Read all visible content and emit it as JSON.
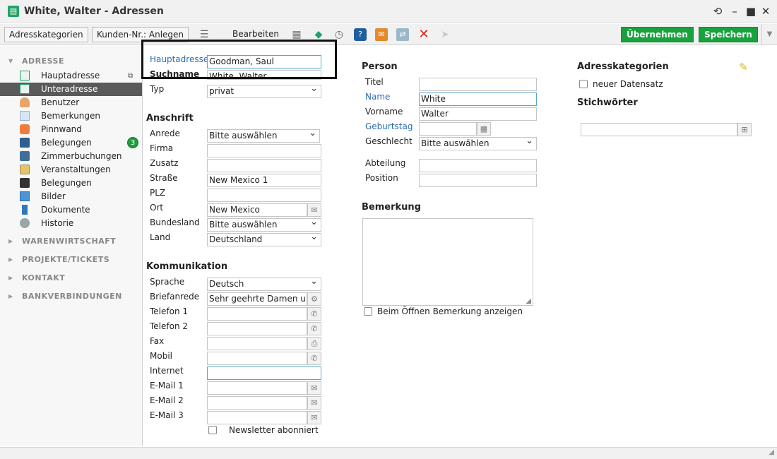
{
  "window": {
    "title": "White, Walter - Adressen"
  },
  "toolbar": {
    "btn_categories": "Adresskategorien",
    "btn_customer_no": "Kunden-Nr.: Anlegen",
    "edit_label": "Bearbeiten",
    "apply_label": "Übernehmen",
    "save_label": "Speichern"
  },
  "sidebar": {
    "sections": {
      "address": "ADRESSE",
      "inventory": "WARENWIRTSCHAFT",
      "projects": "PROJEKTE/TICKETS",
      "contact": "KONTAKT",
      "bank": "BANKVERBINDUNGEN"
    },
    "items": [
      {
        "label": "Hauptadresse",
        "icon": "address-card-icon"
      },
      {
        "label": "Unteradresse",
        "icon": "address-card-icon"
      },
      {
        "label": "Benutzer",
        "icon": "user-icon"
      },
      {
        "label": "Bemerkungen",
        "icon": "comment-icon"
      },
      {
        "label": "Pinnwand",
        "icon": "pinboard-icon"
      },
      {
        "label": "Belegungen",
        "icon": "booking-icon",
        "badge": "3"
      },
      {
        "label": "Zimmerbuchungen",
        "icon": "bed-icon"
      },
      {
        "label": "Veranstaltungen",
        "icon": "event-icon"
      },
      {
        "label": "Belegungen",
        "icon": "booking-icon"
      },
      {
        "label": "Bilder",
        "icon": "grid-icon"
      },
      {
        "label": "Dokumente",
        "icon": "document-icon"
      },
      {
        "label": "Historie",
        "icon": "history-icon"
      }
    ]
  },
  "form": {
    "main_address_label": "Hauptadresse",
    "main_address_value": "Goodman, Saul",
    "search_name_label": "Suchname",
    "search_name_value": "White, Walter",
    "type_label": "Typ",
    "type_value": "privat",
    "anschrift": {
      "heading": "Anschrift",
      "salutation_label": "Anrede",
      "salutation_value": "Bitte auswählen",
      "company_label": "Firma",
      "company_value": "",
      "addition_label": "Zusatz",
      "addition_value": "",
      "street_label": "Straße",
      "street_value": "New Mexico 1",
      "zip_label": "PLZ",
      "zip_value": "",
      "city_label": "Ort",
      "city_value": "New Mexico",
      "state_label": "Bundesland",
      "state_value": "Bitte auswählen",
      "country_label": "Land",
      "country_value": "Deutschland"
    },
    "kommunikation": {
      "heading": "Kommunikation",
      "language_label": "Sprache",
      "language_value": "Deutsch",
      "letter_salutation_label": "Briefanrede",
      "letter_salutation_value": "Sehr geehrte Damen und",
      "phone1_label": "Telefon 1",
      "phone1_value": "",
      "phone2_label": "Telefon 2",
      "phone2_value": "",
      "fax_label": "Fax",
      "fax_value": "",
      "mobile_label": "Mobil",
      "mobile_value": "",
      "internet_label": "Internet",
      "internet_value": "",
      "email1_label": "E-Mail 1",
      "email1_value": "",
      "email2_label": "E-Mail 2",
      "email2_value": "",
      "email3_label": "E-Mail 3",
      "email3_value": "",
      "newsletter_label": "Newsletter abonniert"
    },
    "person": {
      "heading": "Person",
      "title_label": "Titel",
      "title_value": "",
      "name_label": "Name",
      "name_value": "White",
      "firstname_label": "Vorname",
      "firstname_value": "Walter",
      "birthday_label": "Geburtstag",
      "birthday_value": "",
      "gender_label": "Geschlecht",
      "gender_value": "Bitte auswählen",
      "department_label": "Abteilung",
      "department_value": "",
      "position_label": "Position",
      "position_value": ""
    },
    "remark": {
      "heading": "Bemerkung",
      "show_on_open_label": "Beim Öffnen Bemerkung anzeigen"
    },
    "categories": {
      "heading": "Adresskategorien",
      "new_record_label": "neuer Datensatz"
    },
    "keywords": {
      "heading": "Stichwörter",
      "value": ""
    }
  },
  "colors": {
    "accent_green": "#17a23e",
    "link_blue": "#2a6db5",
    "active_nav": "#5a5a5a"
  }
}
